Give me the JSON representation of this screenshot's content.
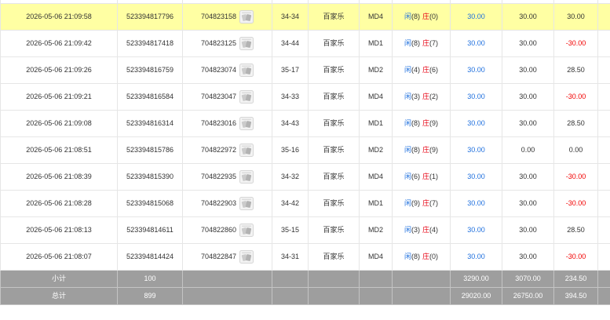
{
  "colors": {
    "text": "#333333",
    "border": "#e6e6e6",
    "bet_blue": "#1e6fde",
    "player_blue": "#1e6fde",
    "banker_red": "#e60012",
    "negative_red": "#f20000",
    "summary_bg": "#9e9e9e",
    "summary_text": "#ffffff",
    "summary_border": "#c4c4c4"
  },
  "icons": {
    "result_thumbnail": "playing-cards-icon"
  },
  "rows": [
    {
      "bg": "#ffffa3",
      "time": "2026-05-06 21:09:58",
      "bet_no": "523394817796",
      "game_no": "704823158",
      "table": "34-34",
      "game": "百家乐",
      "md": "MD4",
      "player_label": "闲",
      "player_score": "(8)",
      "banker_label": "庄",
      "banker_score": "(0)",
      "bet": "30.00",
      "valid_bet": "30.00",
      "win_loss": "30.00"
    },
    {
      "bg": "#ffffff",
      "time": "2026-05-06 21:09:42",
      "bet_no": "523394817418",
      "game_no": "704823125",
      "table": "34-44",
      "game": "百家乐",
      "md": "MD1",
      "player_label": "闲",
      "player_score": "(8)",
      "banker_label": "庄",
      "banker_score": "(7)",
      "bet": "30.00",
      "valid_bet": "30.00",
      "win_loss": "-30.00"
    },
    {
      "bg": "#ffffff",
      "time": "2026-05-06 21:09:26",
      "bet_no": "523394816759",
      "game_no": "704823074",
      "table": "35-17",
      "game": "百家乐",
      "md": "MD2",
      "player_label": "闲",
      "player_score": "(4)",
      "banker_label": "庄",
      "banker_score": "(6)",
      "bet": "30.00",
      "valid_bet": "30.00",
      "win_loss": "28.50"
    },
    {
      "bg": "#ffffff",
      "time": "2026-05-06 21:09:21",
      "bet_no": "523394816584",
      "game_no": "704823047",
      "table": "34-33",
      "game": "百家乐",
      "md": "MD4",
      "player_label": "闲",
      "player_score": "(3)",
      "banker_label": "庄",
      "banker_score": "(2)",
      "bet": "30.00",
      "valid_bet": "30.00",
      "win_loss": "-30.00"
    },
    {
      "bg": "#ffffff",
      "time": "2026-05-06 21:09:08",
      "bet_no": "523394816314",
      "game_no": "704823016",
      "table": "34-43",
      "game": "百家乐",
      "md": "MD1",
      "player_label": "闲",
      "player_score": "(8)",
      "banker_label": "庄",
      "banker_score": "(9)",
      "bet": "30.00",
      "valid_bet": "30.00",
      "win_loss": "28.50"
    },
    {
      "bg": "#ffffff",
      "time": "2026-05-06 21:08:51",
      "bet_no": "523394815786",
      "game_no": "704822972",
      "table": "35-16",
      "game": "百家乐",
      "md": "MD2",
      "player_label": "闲",
      "player_score": "(8)",
      "banker_label": "庄",
      "banker_score": "(9)",
      "bet": "30.00",
      "valid_bet": "0.00",
      "win_loss": "0.00"
    },
    {
      "bg": "#ffffff",
      "time": "2026-05-06 21:08:39",
      "bet_no": "523394815390",
      "game_no": "704822935",
      "table": "34-32",
      "game": "百家乐",
      "md": "MD4",
      "player_label": "闲",
      "player_score": "(6)",
      "banker_label": "庄",
      "banker_score": "(1)",
      "bet": "30.00",
      "valid_bet": "30.00",
      "win_loss": "-30.00"
    },
    {
      "bg": "#ffffff",
      "time": "2026-05-06 21:08:28",
      "bet_no": "523394815068",
      "game_no": "704822903",
      "table": "34-42",
      "game": "百家乐",
      "md": "MD1",
      "player_label": "闲",
      "player_score": "(9)",
      "banker_label": "庄",
      "banker_score": "(7)",
      "bet": "30.00",
      "valid_bet": "30.00",
      "win_loss": "-30.00"
    },
    {
      "bg": "#ffffff",
      "time": "2026-05-06 21:08:13",
      "bet_no": "523394814611",
      "game_no": "704822860",
      "table": "35-15",
      "game": "百家乐",
      "md": "MD2",
      "player_label": "闲",
      "player_score": "(3)",
      "banker_label": "庄",
      "banker_score": "(4)",
      "bet": "30.00",
      "valid_bet": "30.00",
      "win_loss": "28.50"
    },
    {
      "bg": "#ffffff",
      "time": "2026-05-06 21:08:07",
      "bet_no": "523394814424",
      "game_no": "704822847",
      "table": "34-31",
      "game": "百家乐",
      "md": "MD4",
      "player_label": "闲",
      "player_score": "(8)",
      "banker_label": "庄",
      "banker_score": "(0)",
      "bet": "30.00",
      "valid_bet": "30.00",
      "win_loss": "-30.00"
    }
  ],
  "summary": [
    {
      "label": "小计",
      "count": "100",
      "bet": "3290.00",
      "valid_bet": "3070.00",
      "win_loss": "234.50"
    },
    {
      "label": "总计",
      "count": "899",
      "bet": "29020.00",
      "valid_bet": "26750.00",
      "win_loss": "394.50"
    }
  ]
}
